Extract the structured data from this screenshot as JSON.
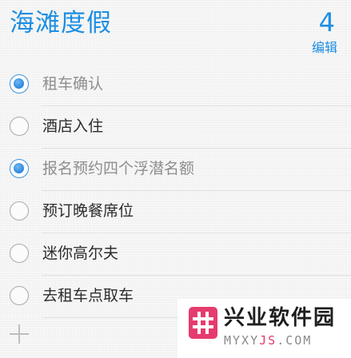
{
  "header": {
    "title": "海滩度假",
    "count": "4",
    "edit_label": "编辑"
  },
  "items": [
    {
      "label": "租车确认",
      "completed": true
    },
    {
      "label": "酒店入住",
      "completed": false
    },
    {
      "label": "报名预约四个浮潜名额",
      "completed": true
    },
    {
      "label": "预订晚餐席位",
      "completed": false
    },
    {
      "label": "迷你高尔夫",
      "completed": false
    },
    {
      "label": "去租车点取车",
      "completed": false
    }
  ],
  "icons": {
    "checkbox": "circle-checkbox-icon",
    "add": "plus-icon",
    "watermark_logo": "hash-logo-icon"
  },
  "watermark": {
    "brand": "兴业软件园",
    "url_part1": "MYXY",
    "url_part2": "JS",
    "url_part3": ".COM"
  },
  "colors": {
    "accent": "#1d8ee3",
    "check": "#2a86dc",
    "watermark_pink": "#e63b6e"
  }
}
